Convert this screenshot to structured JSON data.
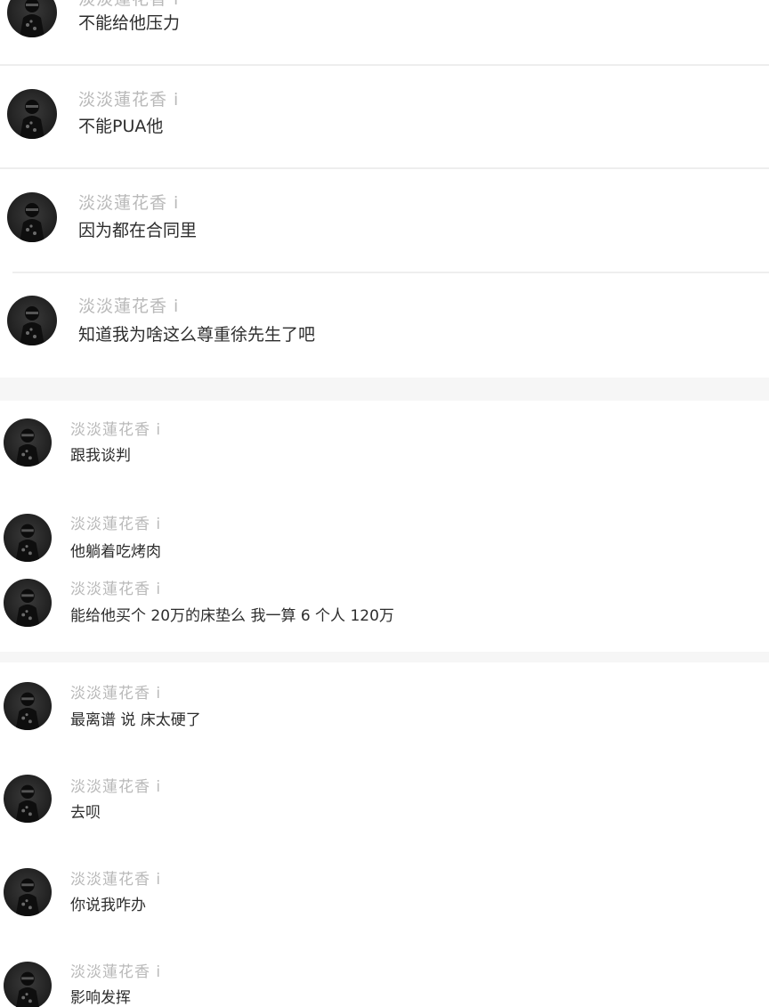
{
  "username": "淡淡蓮花香 i",
  "section1": {
    "messages": [
      {
        "text": "不能给他压力"
      },
      {
        "text": "不能PUA他"
      },
      {
        "text": "因为都在合同里"
      },
      {
        "text": "知道我为啥这么尊重徐先生了吧"
      }
    ]
  },
  "section2": {
    "messages": [
      {
        "text": "跟我谈判"
      },
      {
        "text": "他躺着吃烤肉"
      },
      {
        "text": "能给他买个 20万的床垫么  我一算 6 个人  120万"
      }
    ]
  },
  "section3": {
    "messages": [
      {
        "text": "最离谱 说 床太硬了"
      },
      {
        "text": "去呗"
      },
      {
        "text": "你说我咋办"
      },
      {
        "text": "影响发挥"
      }
    ]
  },
  "icons": {
    "avatar": "user-avatar-icon"
  }
}
